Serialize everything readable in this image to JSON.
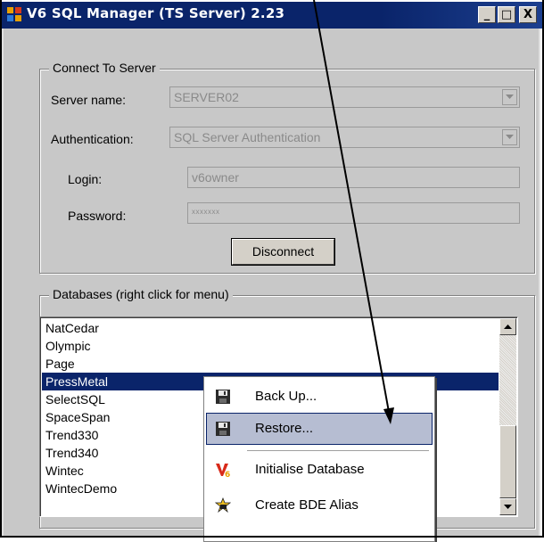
{
  "window": {
    "title": "V6 SQL Manager (TS Server)  2.23",
    "controls": {
      "minimize": "_",
      "maximize": "□",
      "close": "X"
    }
  },
  "connect": {
    "group_label": "Connect To Server",
    "server_label": "Server name:",
    "server_value": "SERVER02",
    "auth_label": "Authentication:",
    "auth_value": "SQL Server Authentication",
    "login_label": "Login:",
    "login_value": "v6owner",
    "password_label": "Password:",
    "password_value": "xxxxxxx",
    "disconnect_label": "Disconnect"
  },
  "databases": {
    "group_label": "Databases (right click for menu)",
    "items": [
      "NatCedar",
      "Olympic",
      "Page",
      "PressMetal",
      "SelectSQL",
      "SpaceSpan",
      "Trend330",
      "Trend340",
      "Wintec",
      "WintecDemo"
    ],
    "selected": "PressMetal"
  },
  "context_menu": {
    "items": [
      {
        "label": "Back Up...",
        "icon": "floppy-disk-icon"
      },
      {
        "label": "Restore...",
        "icon": "floppy-disk-icon"
      },
      {
        "label": "Initialise Database",
        "icon": "v6-logo-icon"
      },
      {
        "label": "Create BDE Alias",
        "icon": "bde-alias-icon"
      }
    ],
    "highlighted": "Restore..."
  },
  "colors": {
    "title_bar": "#0a246a",
    "selection": "#0a246a",
    "menu_highlight": "#b6bdd2",
    "dialog_bg": "#c8c8c8"
  }
}
